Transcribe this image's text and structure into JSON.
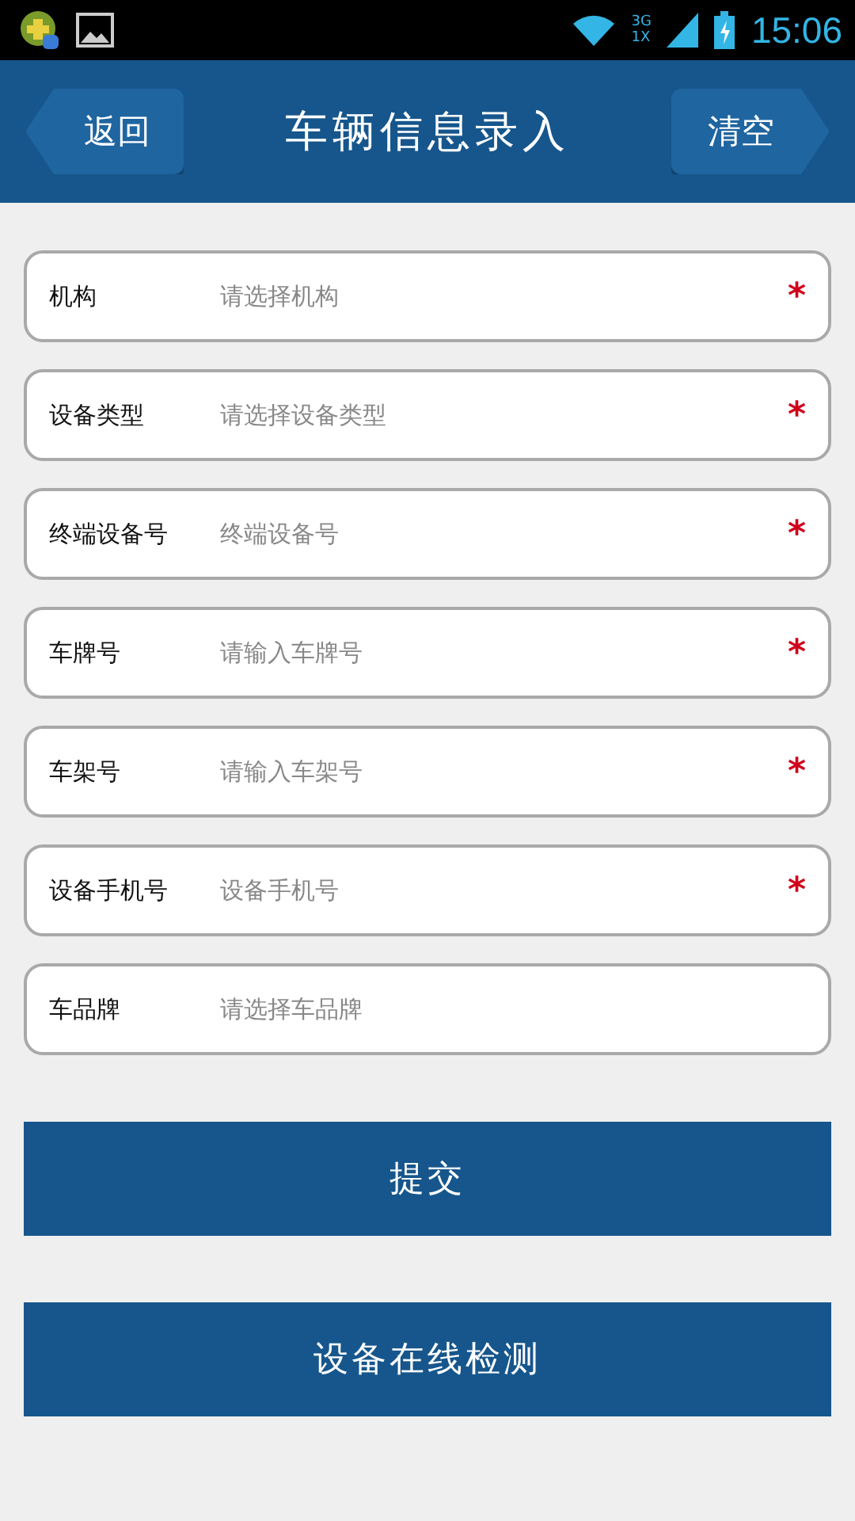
{
  "status_bar": {
    "network_top": "3G",
    "network_bottom": "1X",
    "time": "15:06"
  },
  "header": {
    "back": "返回",
    "title": "车辆信息录入",
    "clear": "清空"
  },
  "fields": [
    {
      "label": "机构",
      "placeholder": "请选择机构",
      "required": true
    },
    {
      "label": "设备类型",
      "placeholder": "请选择设备类型",
      "required": true
    },
    {
      "label": "终端设备号",
      "placeholder": "终端设备号",
      "required": true
    },
    {
      "label": "车牌号",
      "placeholder": "请输入车牌号",
      "required": true
    },
    {
      "label": "车架号",
      "placeholder": "请输入车架号",
      "required": true
    },
    {
      "label": "设备手机号",
      "placeholder": "设备手机号",
      "required": true
    },
    {
      "label": "车品牌",
      "placeholder": "请选择车品牌",
      "required": false
    }
  ],
  "required_mark": "*",
  "buttons": [
    "提交",
    "设备在线检测"
  ]
}
